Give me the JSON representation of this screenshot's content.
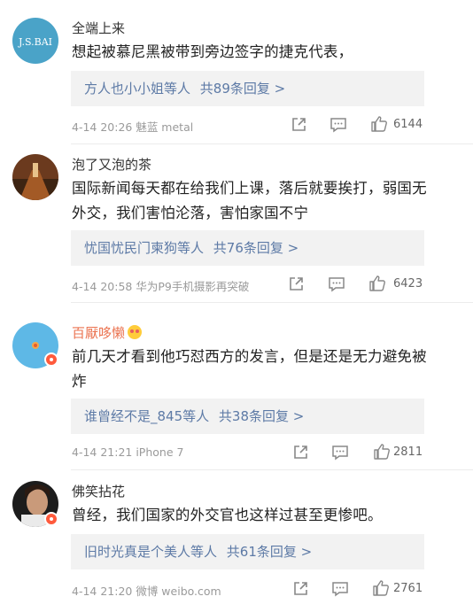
{
  "comments": [
    {
      "username": "全端上来",
      "avatar_text": "J.S.BAI",
      "text": "想起被慕尼黑被带到旁边签字的捷克代表，",
      "reply_users": "方人也小小姐等人",
      "reply_count": "共89条回复 >",
      "meta": "4-14 20:26 魅蓝 metal",
      "likes": "6144"
    },
    {
      "username": "泡了又泡的茶",
      "text": "国际新闻每天都在给我们上课，落后就要挨打，弱国无外交，我们害怕沦落，害怕家国不宁",
      "reply_users": "忧国忧民门柬狗等人",
      "reply_count": "共76条回复 >",
      "meta": "4-14 20:58 华为P9手机摄影再突破",
      "likes": "6423"
    },
    {
      "username": "百厭哆懒",
      "text": "前几天才看到他巧怼西方的发言，但是还是无力避免被炸",
      "reply_users": "谁曾经不是_845等人",
      "reply_count": "共38条回复 >",
      "meta": "4-14 21:21 iPhone 7",
      "likes": "2811"
    },
    {
      "username": "佛笑拈花",
      "text": "曾经，我们国家的外交官也这样过甚至更惨吧。",
      "reply_users": "旧时光真是个美人等人",
      "reply_count": "共61条回复 >",
      "meta": "4-14 21:20 微博 weibo.com",
      "likes": "2761"
    }
  ],
  "colors": {
    "link": "#5d7aa6",
    "meta": "#9a9a9a",
    "reply_bg": "#f2f2f2",
    "highlight_name": "#eb7350"
  },
  "icons": [
    "share-icon",
    "comment-icon",
    "like-icon",
    "vip-badge-icon",
    "emoji-icon"
  ]
}
